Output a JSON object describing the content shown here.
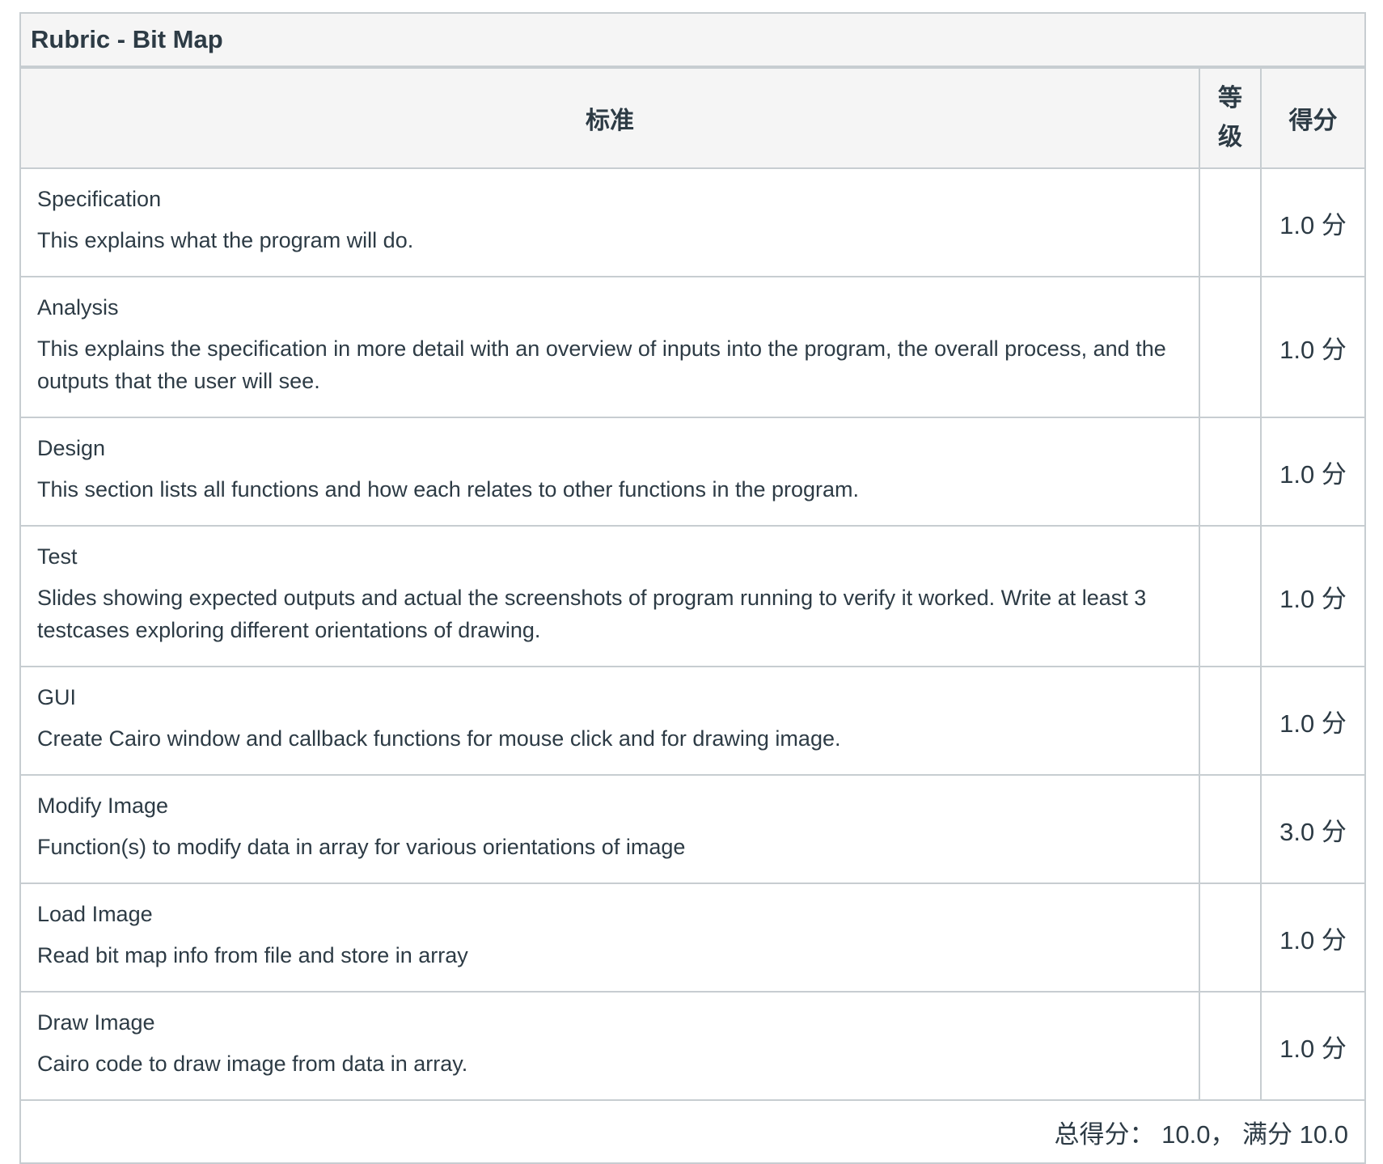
{
  "rubric": {
    "title": "Rubric - Bit Map",
    "headers": {
      "criteria": "标准",
      "rating": "等级",
      "points": "得分"
    },
    "criteria": [
      {
        "name": "Specification",
        "description": "This explains what the program will do.",
        "points": "1.0 分"
      },
      {
        "name": "Analysis",
        "description": "This explains the specification in more detail with an overview of inputs into the program, the overall process, and the outputs that the user will see.",
        "points": "1.0 分"
      },
      {
        "name": "Design",
        "description": "This section lists all functions and how each relates to other functions in the program.",
        "points": "1.0 分"
      },
      {
        "name": "Test",
        "description": "Slides showing expected outputs and actual the screenshots of program running to verify it worked. Write at least 3 testcases exploring different orientations of drawing.",
        "points": "1.0 分"
      },
      {
        "name": "GUI",
        "description": "Create Cairo window and callback functions for mouse click and for drawing image.",
        "points": "1.0 分"
      },
      {
        "name": "Modify Image",
        "description": "Function(s) to modify data in array for various orientations of image",
        "points": "3.0 分"
      },
      {
        "name": "Load Image",
        "description": "Read bit map info from file and store in array",
        "points": "1.0 分"
      },
      {
        "name": "Draw Image",
        "description": "Cairo code to draw image from data in array.",
        "points": "1.0 分"
      }
    ],
    "total": "总得分： 10.0， 满分 10.0"
  },
  "colors": {
    "header_bg": "#f5f5f5",
    "border": "#c7cdd1",
    "text": "#2d3b45"
  }
}
